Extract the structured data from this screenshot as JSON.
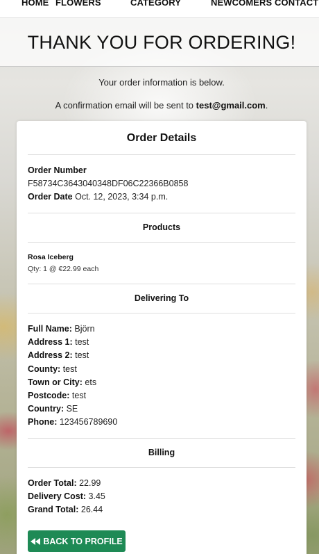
{
  "nav": {
    "home": "HOME",
    "flowers": "FLOWERS",
    "category": "CATEGORY",
    "newcomers": "NEWCOMERS",
    "contact": "CONTACT"
  },
  "hero": {
    "title": "THANK YOU FOR ORDERING!"
  },
  "intro": {
    "line1": "Your order information is below.",
    "line2_prefix": "A confirmation email will be sent to ",
    "email": "test@gmail.com",
    "line2_suffix": "."
  },
  "card": {
    "title": "Order Details",
    "order_number_label": "Order Number",
    "order_number": "F58734C3643040348DF06C22366B0858",
    "order_date_label": "Order Date",
    "order_date": "Oct. 12, 2023, 3:34 p.m.",
    "products_title": "Products",
    "products": [
      {
        "name": "Rosa Iceberg",
        "qty_line": "Qty: 1 @ €22.99 each"
      }
    ],
    "delivering_title": "Delivering To",
    "delivery": {
      "full_name_label": "Full Name:",
      "full_name": "Björn",
      "address1_label": "Address 1:",
      "address1": "test",
      "address2_label": "Address 2:",
      "address2": "test",
      "county_label": "County:",
      "county": "test",
      "town_label": "Town or City:",
      "town": "ets",
      "postcode_label": "Postcode:",
      "postcode": "test",
      "country_label": "Country:",
      "country": "SE",
      "phone_label": "Phone:",
      "phone": "123456789690"
    },
    "billing_title": "Billing",
    "billing": {
      "order_total_label": "Order Total:",
      "order_total": "22.99",
      "delivery_cost_label": "Delivery Cost:",
      "delivery_cost": "3.45",
      "grand_total_label": "Grand Total:",
      "grand_total": "26.44"
    },
    "back_button": "BACK TO PROFILE"
  },
  "colors": {
    "button": "#1e8a55",
    "card": "#ffffff"
  },
  "icons": {
    "back": "double-left-arrow-icon"
  }
}
